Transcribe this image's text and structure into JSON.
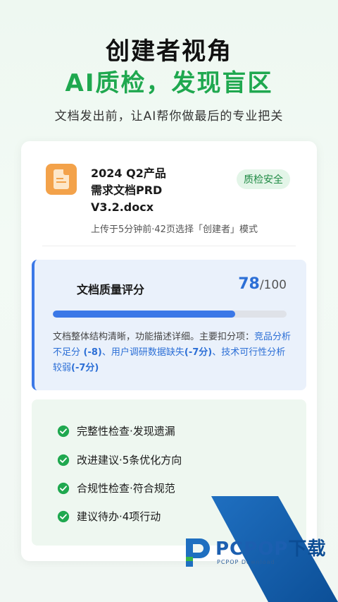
{
  "hero": {
    "line1": "创建者视角",
    "line2": "AI质检，发现盲区",
    "subtitle": "文档发出前，让AI帮你做最后的专业把关"
  },
  "file": {
    "title_line1": "2024  Q2产品",
    "title_line2": "需求文档PRD",
    "title_line3": "V3.2.docx",
    "meta": "上传于5分钟前·42页选择「创建者」模式",
    "badge": "质检安全",
    "icon": "document-icon"
  },
  "score": {
    "label": "文档质量评分",
    "value": "78",
    "max": "/100",
    "progress_fraction": 0.78,
    "desc_prefix": "文档整体结构清晰，功能描述详细。主要扣分项：",
    "issue1_name": "竞品分析不足分",
    "issue1_score": " (-8)",
    "sep1": "、",
    "issue2_name": "用户调研数据缺失",
    "issue2_score": "(-7分)",
    "sep2": "、",
    "issue3_name": "技术可行性分析较弱",
    "issue3_score": "(-7分)"
  },
  "checks": [
    {
      "text": "完整性检查·发现遗漏",
      "icon": "check-circle-icon"
    },
    {
      "text": "改进建议·5条优化方向",
      "icon": "check-circle-icon"
    },
    {
      "text": "合规性检查·符合规范",
      "icon": "check-circle-icon"
    },
    {
      "text": "建议待办·4项行动",
      "icon": "check-circle-icon"
    }
  ],
  "watermark": {
    "brand": "PCPOP",
    "brand_cn": "下载",
    "small": "PCPOP Download"
  },
  "colors": {
    "accent_green": "#1fa84f",
    "accent_blue": "#3b78e7",
    "file_orange": "#f3a24a"
  }
}
